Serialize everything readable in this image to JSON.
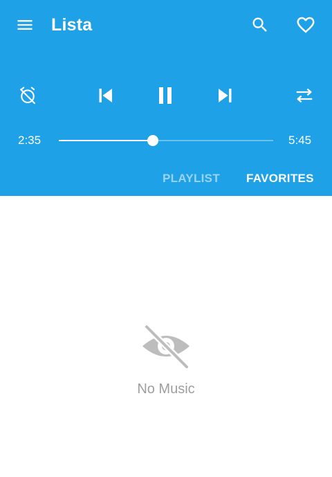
{
  "app_bar": {
    "title": "Lista",
    "icons": {
      "menu": "menu-icon",
      "search": "search-icon",
      "favorite": "heart-outline-icon"
    }
  },
  "player": {
    "controls": [
      "sleep-timer-off-icon",
      "skip-previous-icon",
      "pause-icon",
      "skip-next-icon",
      "repeat-icon"
    ],
    "current_time": "2:35",
    "total_time": "5:45",
    "progress": 0.44
  },
  "tabs": [
    {
      "label": "PLAYLIST",
      "selected": false
    },
    {
      "label": "FAVORITES",
      "selected": true
    }
  ],
  "empty_state": {
    "icon": "eye-off-icon",
    "message": "No Music"
  },
  "colors": {
    "primary": "#1ea1e6",
    "on_primary": "#ffffff",
    "muted_text": "#9e9e9e",
    "empty_icon": "#bdbdbd"
  }
}
